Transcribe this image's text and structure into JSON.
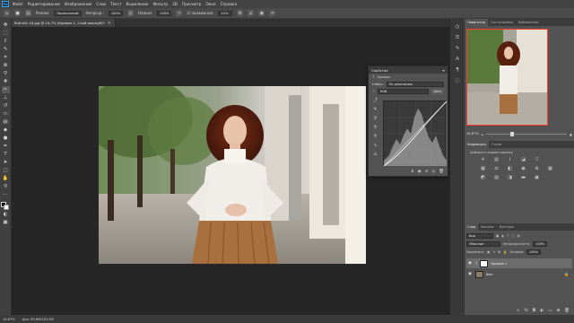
{
  "app": {
    "logo": "Ps"
  },
  "menu": [
    "Файл",
    "Редактирование",
    "Изображение",
    "Слои",
    "Текст",
    "Выделение",
    "Фильтр",
    "3D",
    "Просмотр",
    "Окно",
    "Справка"
  ],
  "options": {
    "mode_label": "Режим:",
    "mode_value": "Нормальный",
    "opacity_label": "Непрозр.:",
    "opacity_value": "100%",
    "flow_label": "Нажим:",
    "flow_value": "100%",
    "smooth_label": "Сглаживание:",
    "smooth_value": "10%"
  },
  "document": {
    "tab_title": "Rothirth 16.jpg @ 16,7% (Кривые 1, Слой-маска/8)*",
    "close": "×"
  },
  "properties": {
    "title": "Свойства",
    "subtitle": "Кривые",
    "preset_label": "Набор:",
    "preset_value": "По умолчанию",
    "channel_value": "RGB",
    "auto_label": "Авто"
  },
  "navigator": {
    "tabs": [
      "Навигатор",
      "Гистограмма",
      "Библиотеки"
    ],
    "zoom": "16,67%"
  },
  "adjustments": {
    "tabs": [
      "Коррекция",
      "Стили"
    ],
    "add_label": "Добавить корректировку"
  },
  "layers": {
    "tabs": [
      "Слои",
      "Каналы",
      "Контуры"
    ],
    "kind_label": "Вид",
    "blend_value": "Обычные",
    "opacity_label": "Непрозрачность:",
    "opacity_value": "100%",
    "lock_label": "Закрепить:",
    "fill_label": "Заливка:",
    "fill_value": "100%",
    "items": [
      {
        "name": "Кривые 1"
      },
      {
        "name": "Фон"
      }
    ]
  },
  "status": {
    "zoom": "16,67%",
    "doc_size": "Док: 85,8M/202,6M"
  }
}
